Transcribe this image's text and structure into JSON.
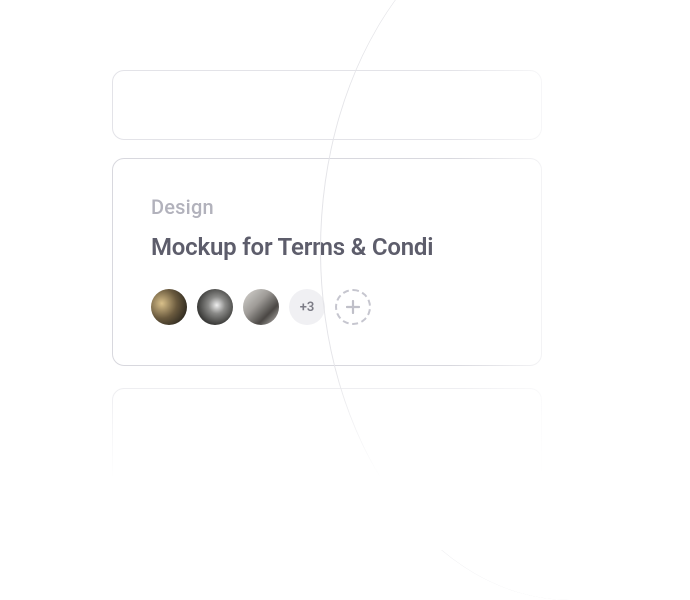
{
  "card": {
    "category": "Design",
    "title": "Mockup for Terms & Condi",
    "avatars": [
      {
        "name": "avatar-1"
      },
      {
        "name": "avatar-2"
      },
      {
        "name": "avatar-3"
      }
    ],
    "overflow_label": "+3",
    "add_icon": "plus-icon"
  },
  "colors": {
    "border": "#d8d8de",
    "category_text": "#b2b2bc",
    "title_text": "#5d5d6b",
    "overflow_bg": "#f0f0f3",
    "overflow_text": "#7c7c86",
    "dashed_border": "#c6c6cf"
  }
}
